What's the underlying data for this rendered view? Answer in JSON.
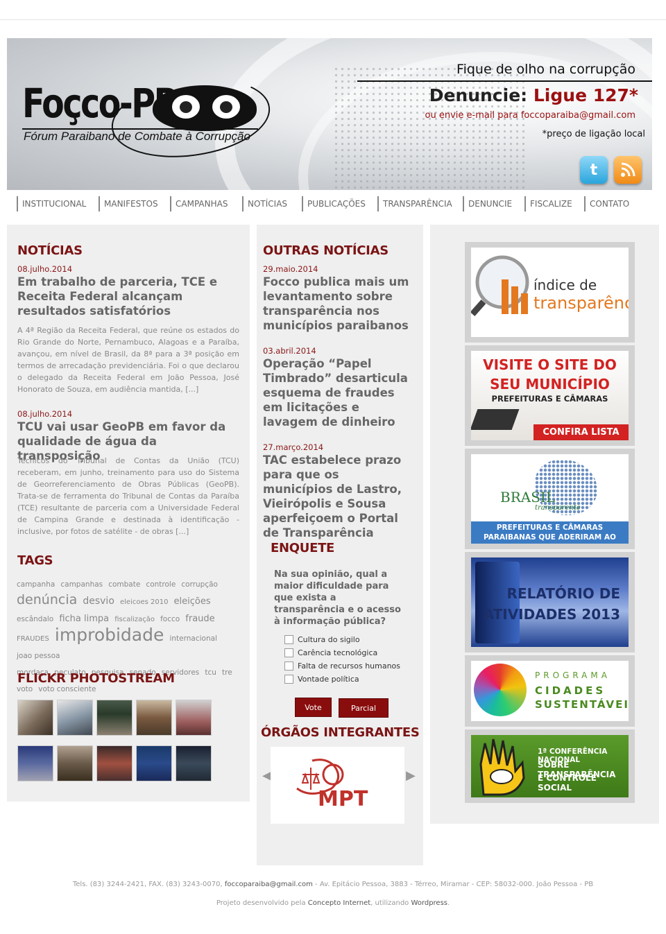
{
  "header": {
    "logo_text": "Foçco-PB",
    "logo_subtitle": "Fórum Paraibano de Combate à Corrupção",
    "tagline": "Fique de olho na corrupção",
    "denuncie_label": "Denuncie:",
    "ligue": "Ligue 127*",
    "email_line": "ou envie e-mail para foccoparaiba@gmail.com",
    "note": "*preço de ligação local",
    "twitter_icon": "twitter-icon",
    "rss_icon": "rss-icon"
  },
  "nav": [
    "INSTITUCIONAL",
    "MANIFESTOS",
    "CAMPANHAS",
    "NOTÍCIAS",
    "PUBLICAÇÕES",
    "TRANSPARÊNCIA",
    "DENUNCIE",
    "FISCALIZE",
    "CONTATO"
  ],
  "noticias": {
    "title": "NOTÍCIAS",
    "items": [
      {
        "date": "08.julho.2014",
        "headline": "Em trabalho de parceria, TCE e Receita Federal alcançam resultados satisfatórios",
        "excerpt": "A 4ª Região da Receita Federal, que reúne os estados do Rio Grande do Norte, Pernambuco, Alagoas e a Paraíba, avançou, em nível de Brasil, da 8ª para a 3ª posição em termos de arrecadação previdenciária. Foi o que declarou o delegado da Receita Federal em João Pessoa, José Honorato de Souza, em audiência mantida, [...]"
      },
      {
        "date": "08.julho.2014",
        "headline": "TCU vai usar GeoPB em favor da qualidade de água da transposição",
        "excerpt": "Técnicos do Tribunal de Contas da União (TCU) receberam, em junho, treinamento para uso do Sistema de Georreferenciamento de Obras Públicas (GeoPB). Trata-se de ferramenta do Tribunal de Contas da Paraíba (TCE) resultante de parceria com a Universidade Federal de Campina Grande e destinada à identificação - inclusive, por fotos de satélite - de obras [...]"
      }
    ]
  },
  "tags": {
    "title": "TAGS",
    "items": [
      "campanha",
      "campanhas",
      "combate",
      "controle",
      "corrupção",
      "denúncia",
      "desvio",
      "eleicoes 2010",
      "eleições",
      "escândalo",
      "ficha limpa",
      "fiscalização",
      "focco",
      "fraude",
      "FRAUDES",
      "improbidade",
      "internacional",
      "joao pessoa",
      "mordaça",
      "peculato",
      "pesquisa",
      "senado",
      "servidores",
      "tcu",
      "tre",
      "voto",
      "voto consciente"
    ]
  },
  "flickr": {
    "title": "FLICKR PHOTOSTREAM"
  },
  "outras": {
    "title": "OUTRAS NOTÍCIAS",
    "items": [
      {
        "date": "29.maio.2014",
        "headline": "Focco publica mais um levantamento sobre transparência nos municípios paraibanos"
      },
      {
        "date": "03.abril.2014",
        "headline": "Operação “Papel Timbrado” desarticula esquema de fraudes em licitações e lavagem de dinheiro"
      },
      {
        "date": "27.março.2014",
        "headline": "TAC estabelece prazo para que os municípios de Lastro, Vieirópolis e Sousa aperfeiçoem o Portal de Transparência"
      }
    ]
  },
  "enquete": {
    "title": "ENQUETE",
    "question": "Na sua opinião, qual a maior dificuldade para que exista a transparência e o acesso à informação pública?",
    "options": [
      "Cultura do sigilo",
      "Carência tecnológica",
      "Falta de recursos humanos",
      "Vontade política"
    ],
    "vote_label": "Vote",
    "parcial_label": "Parcial"
  },
  "orgaos": {
    "title": "ÓRGÃOS INTEGRANTES",
    "logo_text": "MPT"
  },
  "banners": {
    "indice": {
      "line1": "índice de",
      "line2": "transparência"
    },
    "municipio": {
      "line1": "VISITE O SITE DO",
      "line2": "SEU MUNICÍPIO",
      "line3": "PREFEITURAS E CÂMARAS",
      "cta": "CONFIRA LISTA"
    },
    "brasil": {
      "logo1": "BRASIL",
      "logo2": "transparente",
      "caption": "PREFEITURAS E CÂMARAS PARAIBANAS QUE ADERIRAM AO PROGRAMA"
    },
    "relatorio": {
      "line1": "RELATÓRIO DE",
      "line2": "ATIVIDADES 2013"
    },
    "cidades": {
      "line1": "PROGRAMA",
      "line2": "CIDADES",
      "line3": "SUSTENTÁVEIS"
    },
    "conferencia": {
      "line1": "1ª CONFERÊNCIA NACIONAL",
      "line2": "SOBRE TRANSPARÊNCIA",
      "line3": "E CONTROLE SOCIAL"
    }
  },
  "footer": {
    "contact_pre": "Tels. (83) 3244-2421, FAX. (83) 3243-0070,",
    "contact_email": "foccoparaiba@gmail.com",
    "contact_post": "- Av. Epitácio Pessoa, 3883 - Térreo, Miramar - CEP: 58032-000. João Pessoa - PB",
    "credit_pre": "Projeto desenvolvido pela",
    "credit_company": "Concepto Internet",
    "credit_mid": ", utilizando",
    "credit_platform": "Wordpress",
    "credit_end": "."
  }
}
